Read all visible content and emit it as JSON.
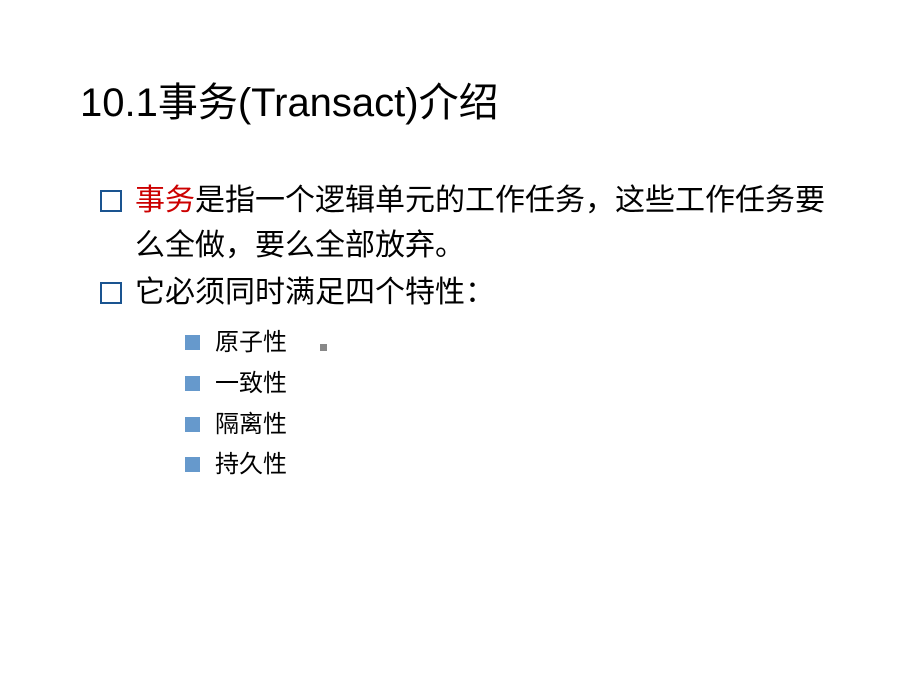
{
  "slide": {
    "title": "10.1事务(Transact)介绍",
    "bullet1": {
      "keyword": "事务",
      "rest": "是指一个逻辑单元的工作任务，这些工作任务要么全做，要么全部放弃。"
    },
    "bullet2": "它必须同时满足四个特性：",
    "sub_bullets": [
      "原子性",
      "一致性",
      "隔离性",
      "持久性"
    ]
  }
}
